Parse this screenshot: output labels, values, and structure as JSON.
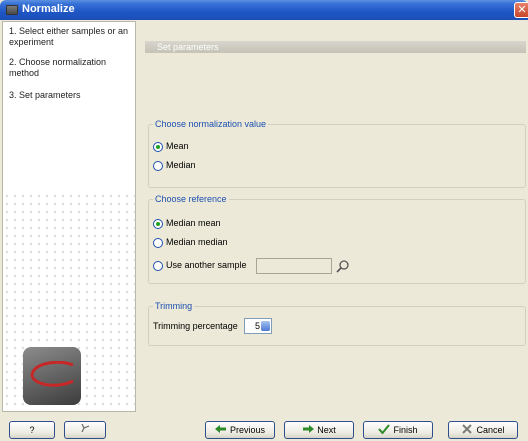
{
  "window": {
    "title": "Normalize"
  },
  "steps": [
    "1. Select either samples or an experiment",
    "2. Choose normalization method",
    "3. Set parameters"
  ],
  "panel": {
    "header": "Set parameters"
  },
  "normalization_value": {
    "title": "Choose normalization value",
    "options": [
      "Mean",
      "Median"
    ],
    "selected": "Mean"
  },
  "reference": {
    "title": "Choose reference",
    "options": [
      "Median mean",
      "Median median",
      "Use another sample"
    ],
    "selected": "Median mean"
  },
  "trimming": {
    "title": "Trimming",
    "label": "Trimming percentage",
    "value": "5"
  },
  "buttons": {
    "help": "?",
    "previous": "Previous",
    "next": "Next",
    "finish": "Finish",
    "cancel": "Cancel"
  },
  "colors": {
    "titlebar": "#1f56c4",
    "group_title": "#1c4fb0",
    "radio_selected": "#21a121"
  }
}
